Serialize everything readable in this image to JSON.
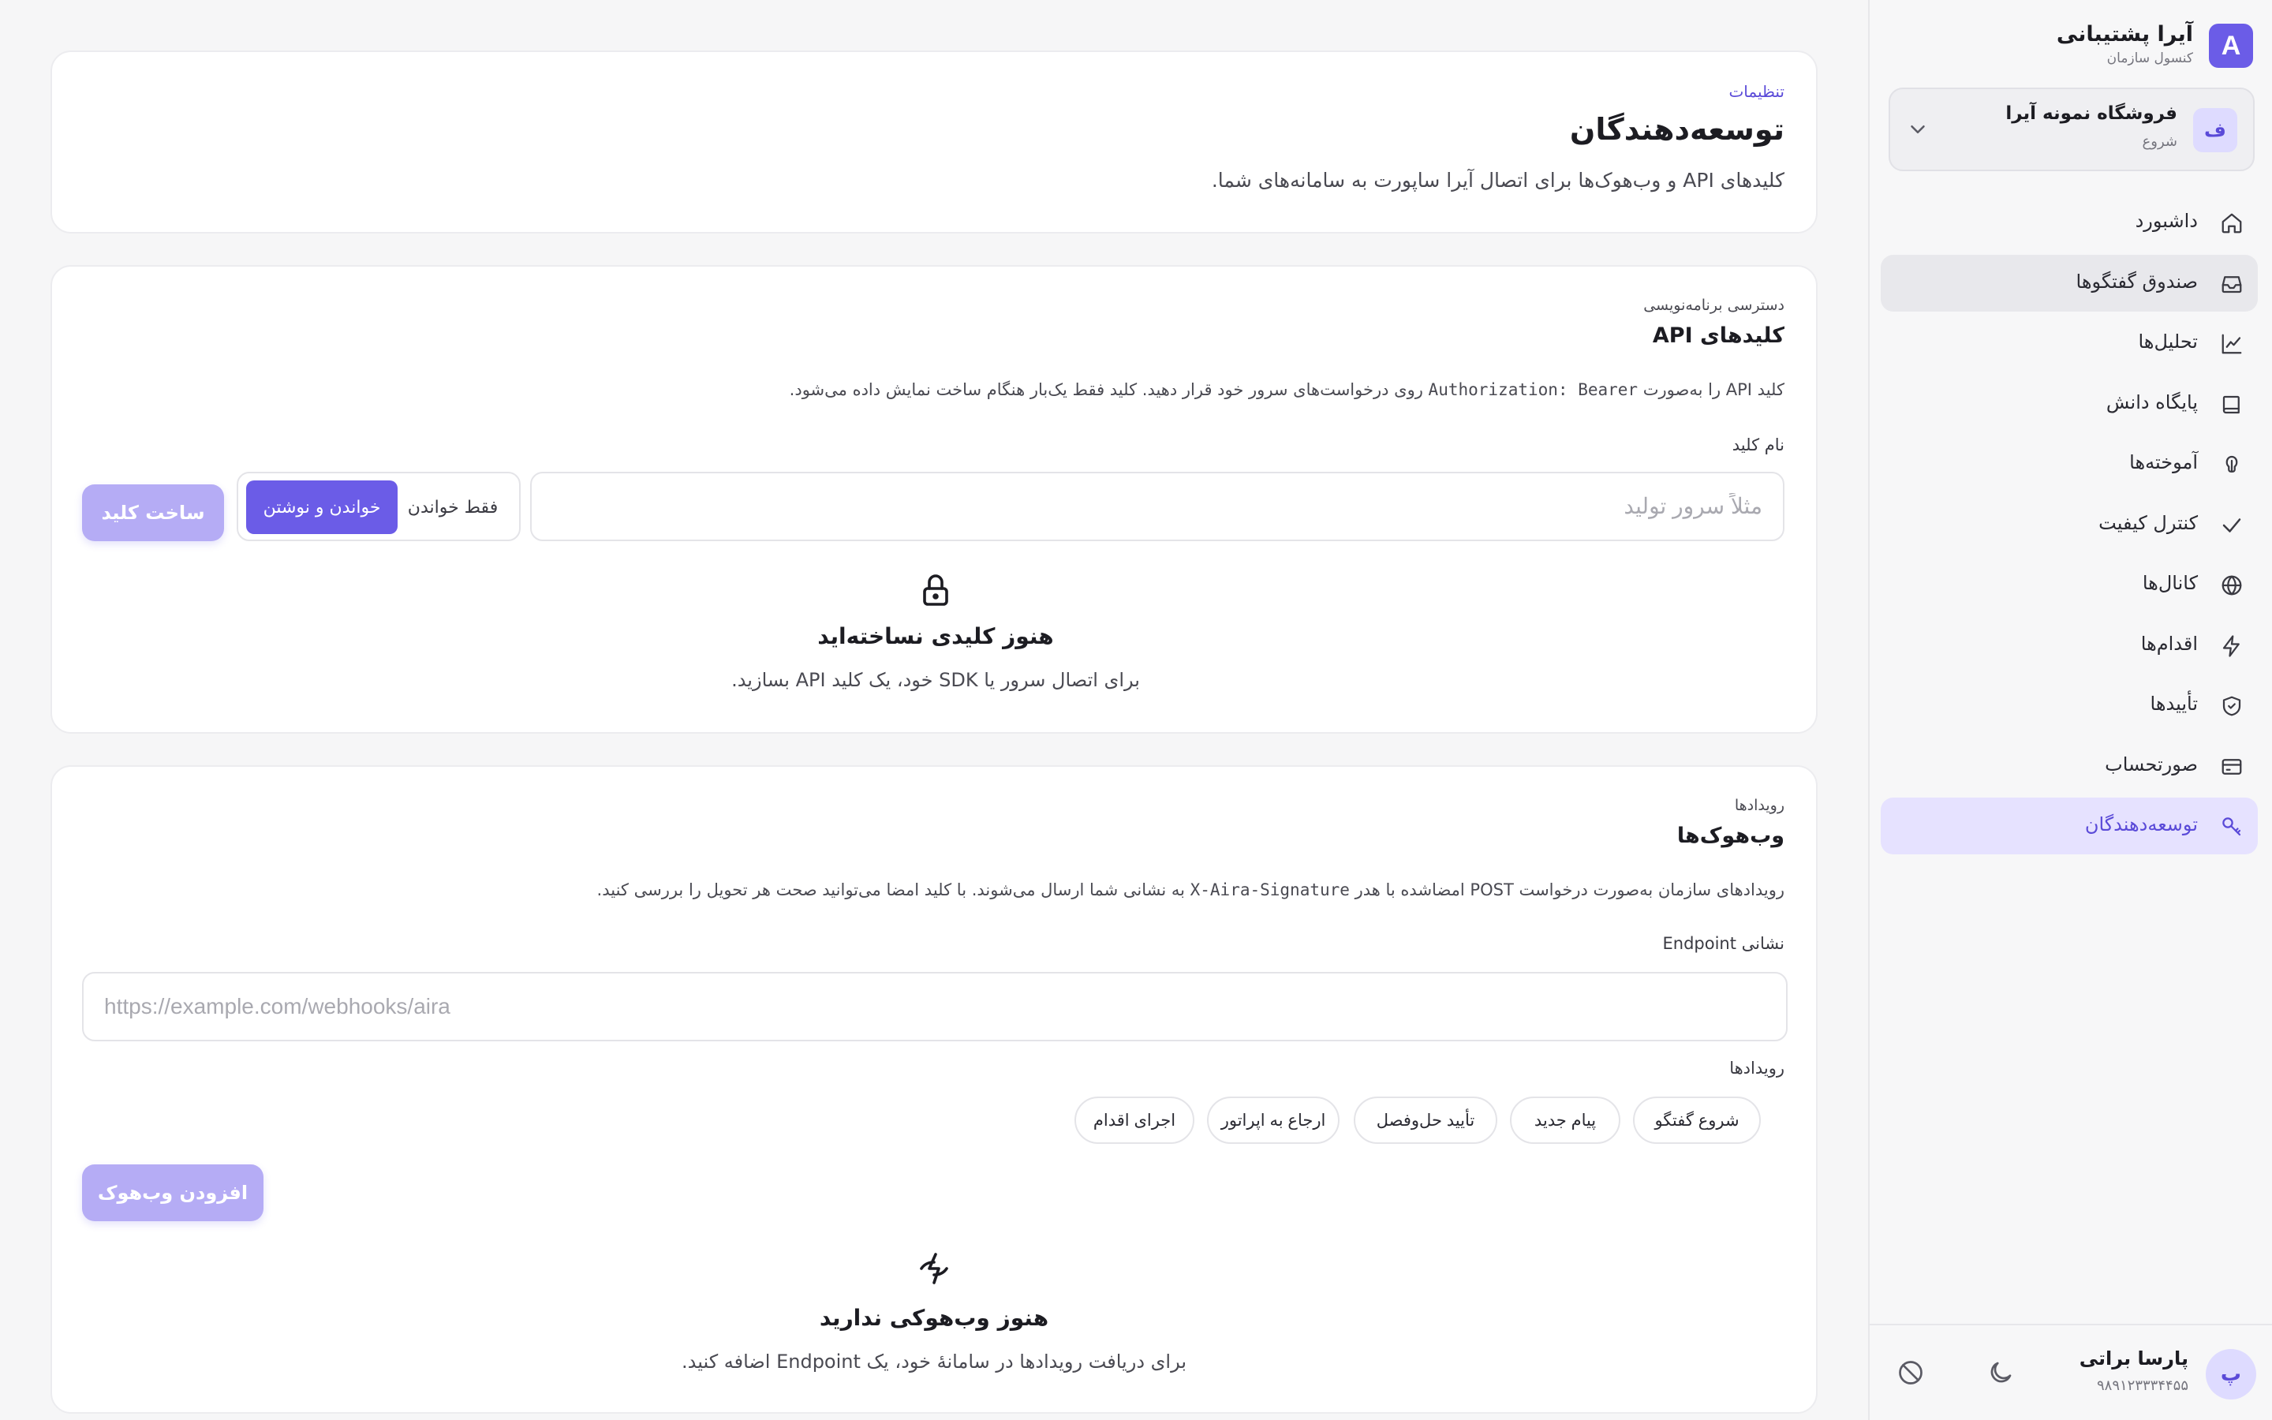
{
  "brand": {
    "logo_letter": "A",
    "title": "آیرا پشتیبانی",
    "subtitle": "کنسول سازمان"
  },
  "org": {
    "avatar_letter": "ف",
    "name": "فروشگاه نمونه آیرا",
    "plan": "شروع"
  },
  "nav": {
    "items": [
      {
        "label": "داشبورد",
        "icon": "home-icon"
      },
      {
        "label": "صندوق گفتگوها",
        "icon": "inbox-icon"
      },
      {
        "label": "تحلیل‌ها",
        "icon": "chart-icon"
      },
      {
        "label": "پایگاه دانش",
        "icon": "book-icon"
      },
      {
        "label": "آموخته‌ها",
        "icon": "brain-icon"
      },
      {
        "label": "کنترل کیفیت",
        "icon": "check-icon"
      },
      {
        "label": "کانال‌ها",
        "icon": "globe-icon"
      },
      {
        "label": "اقدام‌ها",
        "icon": "bolt-icon"
      },
      {
        "label": "تأییدها",
        "icon": "shield-check-icon"
      },
      {
        "label": "صورتحساب",
        "icon": "credit-card-icon"
      },
      {
        "label": "توسعه‌دهندگان",
        "icon": "key-icon"
      }
    ],
    "hovered_index": 1,
    "active_index": 10
  },
  "user": {
    "avatar_letter": "پ",
    "name": "پارسا براتی",
    "phone": "۹۸۹۱۲۳۳۳۴۴۵۵"
  },
  "header": {
    "breadcrumb": "تنظیمات",
    "title": "توسعه‌دهندگان",
    "description": "کلیدهای API و وب‌هوک‌ها برای اتصال آیرا ساپورت به سامانه‌های شما."
  },
  "api_keys": {
    "eyebrow": "دسترسی برنامه‌نویسی",
    "title": "کلیدهای API",
    "description_pre": "کلید API را به‌صورت ",
    "description_code": "Authorization: Bearer",
    "description_post": " روی درخواست‌های سرور خود قرار دهید. کلید فقط یک‌بار هنگام ساخت نمایش داده می‌شود.",
    "name_label": "نام کلید",
    "name_value": "",
    "name_placeholder": "مثلاً سرور تولید",
    "mode_read_only": "فقط خواندن",
    "mode_read_write": "خواندن و نوشتن",
    "selected_mode": "خواندن و نوشتن",
    "create_button": "ساخت کلید",
    "empty_title": "هنوز کلیدی نساخته‌اید",
    "empty_description": "برای اتصال سرور یا SDK خود، یک کلید API بسازید."
  },
  "webhooks": {
    "eyebrow": "رویدادها",
    "title": "وب‌هوک‌ها",
    "description_pre": "رویدادهای سازمان به‌صورت درخواست POST امضاشده با هدر ",
    "description_code": "X-Aira-Signature",
    "description_post": " به نشانی شما ارسال می‌شوند. با کلید امضا می‌توانید صحت هر تحویل را بررسی کنید.",
    "endpoint_label": "نشانی Endpoint",
    "endpoint_value": "",
    "endpoint_placeholder": "https://example.com/webhooks/aira",
    "events_label": "رویدادها",
    "events": [
      "شروع گفتگو",
      "پیام جدید",
      "تأیید حل‌وفصل",
      "ارجاع به اپراتور",
      "اجرای اقدام"
    ],
    "add_button": "افزودن وب‌هوک",
    "empty_title": "هنوز وب‌هوکی ندارید",
    "empty_description": "برای دریافت رویدادها در سامانهٔ خود، یک Endpoint اضافه کنید."
  },
  "colors": {
    "accent": "#6b5ce7",
    "accent_disabled": "#b5acf5",
    "accent_soft": "#e6e2ff",
    "background": "#f6f6f7"
  }
}
